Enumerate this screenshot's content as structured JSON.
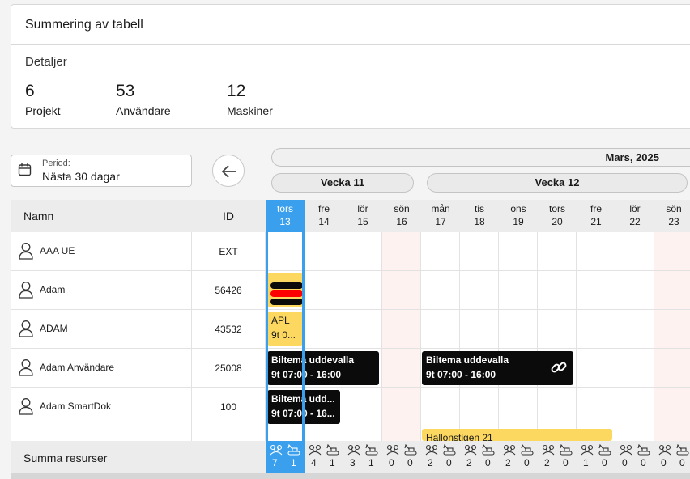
{
  "summary": {
    "title": "Summering av tabell",
    "details_label": "Detaljer",
    "stats": [
      {
        "value": "6",
        "label": "Projekt"
      },
      {
        "value": "53",
        "label": "Användare"
      },
      {
        "value": "12",
        "label": "Maskiner"
      }
    ]
  },
  "period": {
    "label": "Period:",
    "value": "Nästa 30 dagar"
  },
  "calendar": {
    "month": "Mars, 2025",
    "weeks": [
      "Vecka 11",
      "Vecka 12"
    ],
    "columns": {
      "name": "Namn",
      "id": "ID"
    },
    "days": [
      {
        "name": "tors",
        "date": "13",
        "today": true
      },
      {
        "name": "fre",
        "date": "14"
      },
      {
        "name": "lör",
        "date": "15"
      },
      {
        "name": "sön",
        "date": "16",
        "weekend": true
      },
      {
        "name": "mån",
        "date": "17"
      },
      {
        "name": "tis",
        "date": "18"
      },
      {
        "name": "ons",
        "date": "19"
      },
      {
        "name": "tors",
        "date": "20"
      },
      {
        "name": "fre",
        "date": "21"
      },
      {
        "name": "lör",
        "date": "22"
      },
      {
        "name": "sön",
        "date": "23",
        "weekend": true
      }
    ]
  },
  "rows": [
    {
      "name": "AAA UE",
      "id": "EXT"
    },
    {
      "name": "Adam",
      "id": "56426"
    },
    {
      "name": "ADAM",
      "id": "43532"
    },
    {
      "name": "Adam Användare",
      "id": "25008"
    },
    {
      "name": "Adam SmartDok",
      "id": "100"
    },
    {
      "name": "",
      "id": ""
    }
  ],
  "events": {
    "apl_title": "APL",
    "apl_time": "9t 0...",
    "biltema1_title": "Biltema uddevalla",
    "biltema1_time": "9t 07:00 - 16:00",
    "biltema2_title": "Biltema uddevalla",
    "biltema2_time": "9t 07:00 - 16:00",
    "biltema3_title": "Biltema udd...",
    "biltema3_time": "9t 07:00 - 16...",
    "hallon_title": "Hallonstigen 21",
    "colors": {
      "black": "#0b0b0b",
      "yellow": "#fcd860",
      "red": "#ff0000",
      "today": "#3aa0ee"
    }
  },
  "footer": {
    "label": "Summa resurser",
    "sums": [
      {
        "people": "7",
        "machines": "1"
      },
      {
        "people": "4",
        "machines": "1"
      },
      {
        "people": "3",
        "machines": "1"
      },
      {
        "people": "0",
        "machines": "0"
      },
      {
        "people": "2",
        "machines": "0"
      },
      {
        "people": "2",
        "machines": "0"
      },
      {
        "people": "2",
        "machines": "0"
      },
      {
        "people": "2",
        "machines": "0"
      },
      {
        "people": "1",
        "machines": "0"
      },
      {
        "people": "0",
        "machines": "0"
      },
      {
        "people": "0",
        "machines": "0"
      }
    ]
  },
  "icons": {
    "calendar": "calendar-icon",
    "back": "arrow-left-icon",
    "user": "user-icon",
    "link": "link-icon",
    "people": "people-icon",
    "machine": "excavator-icon"
  }
}
